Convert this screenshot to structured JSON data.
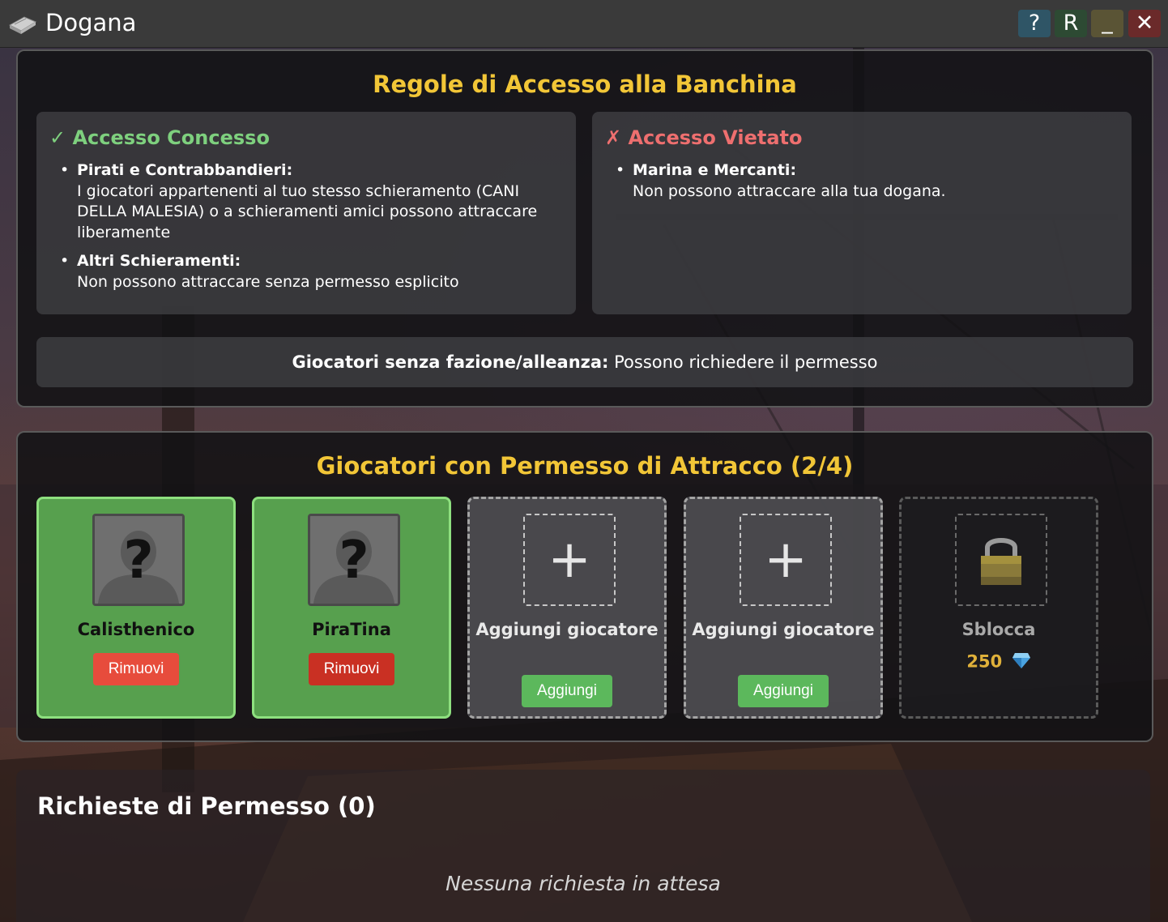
{
  "window": {
    "title": "Dogana",
    "buttons": {
      "help": "?",
      "refresh": "R",
      "minimize": "_",
      "close": "✕"
    }
  },
  "rules": {
    "title": "Regole di Accesso alla Banchina",
    "allowed": {
      "heading": "✓ Accesso Concesso",
      "items": [
        {
          "label": "Pirati e Contrabbandieri:",
          "text": "I giocatori appartenenti al tuo stesso schieramento (CANI DELLA MALESIA) o a schieramenti amici possono attraccare liberamente"
        },
        {
          "label": "Altri Schieramenti:",
          "text": "Non possono attraccare senza permesso esplicito"
        }
      ]
    },
    "denied": {
      "heading": "✗ Accesso Vietato",
      "items": [
        {
          "label": "Marina e Mercanti:",
          "text": "Non possono attraccare alla tua dogana."
        }
      ]
    },
    "no_faction": {
      "label": "Giocatori senza fazione/alleanza:",
      "text": "Possono richiedere il permesso"
    }
  },
  "permits": {
    "title": "Giocatori con Permesso di Attracco (2/4)",
    "players": [
      {
        "name": "Calisthenico",
        "button": "Rimuovi"
      },
      {
        "name": "PiraTina",
        "button": "Rimuovi"
      }
    ],
    "empty_slots": [
      {
        "label": "Aggiungi giocatore",
        "button": "Aggiungi"
      },
      {
        "label": "Aggiungi giocatore",
        "button": "Aggiungi"
      }
    ],
    "locked_slot": {
      "label": "Sblocca",
      "price": "250",
      "currency_icon": "gem-icon"
    }
  },
  "requests": {
    "title": "Richieste di Permesso (0)",
    "empty_text": "Nessuna richiesta in attesa"
  },
  "colors": {
    "title_gold": "#f2c637",
    "allowed_green": "#7ed07e",
    "denied_red": "#ee6f6f",
    "remove_red": "#e74c3c",
    "add_green": "#5cb85c",
    "slot_green": "#57a04e",
    "price_gold": "#e0b13a"
  }
}
